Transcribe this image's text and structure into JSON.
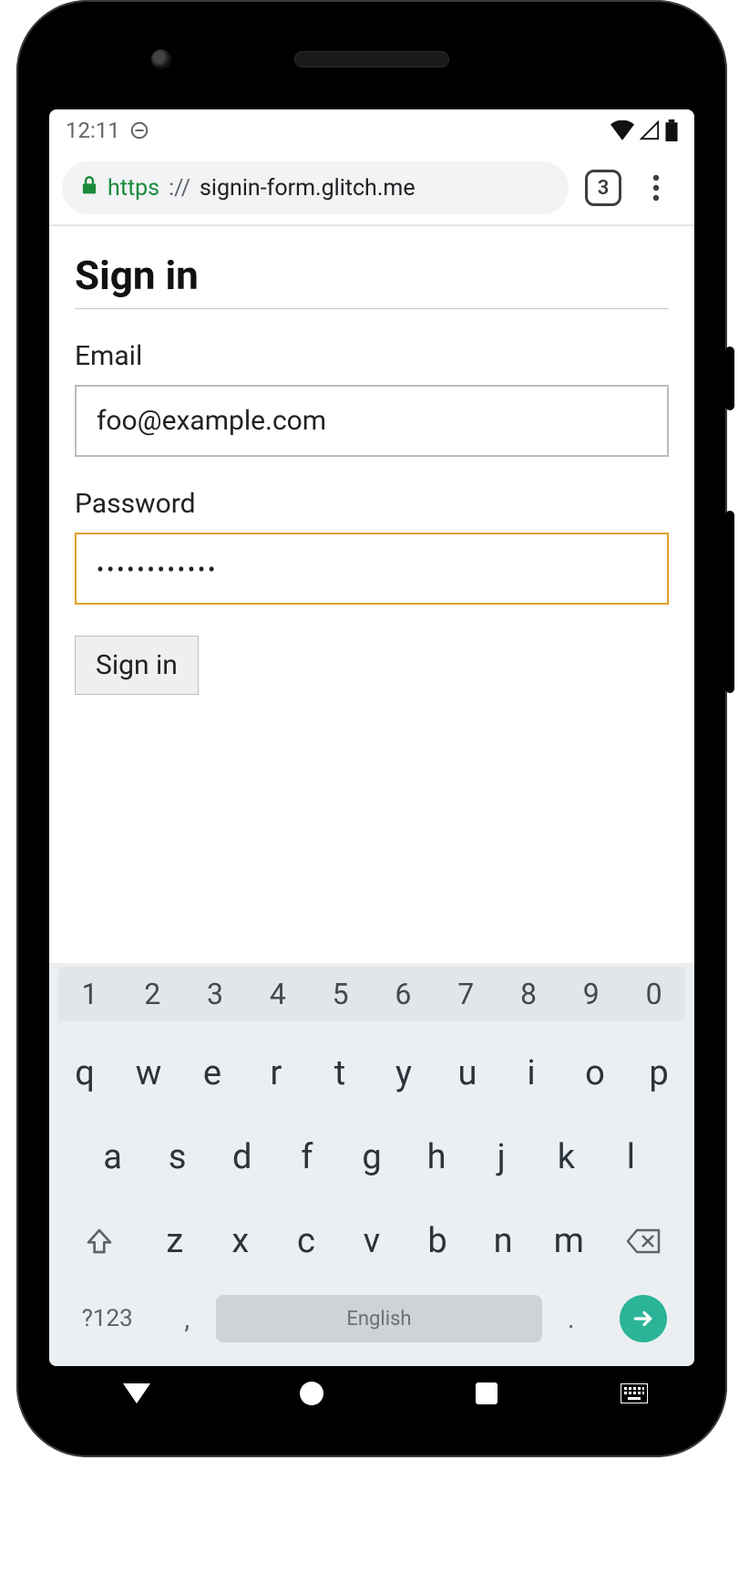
{
  "statusbar": {
    "time": "12:11"
  },
  "browser": {
    "url_protocol": "https",
    "url_sep": "://",
    "url_host": "signin-form.glitch.me",
    "tab_count": "3"
  },
  "page": {
    "title": "Sign in",
    "email_label": "Email",
    "email_value": "foo@example.com",
    "password_label": "Password",
    "password_masked": "••••••••••••",
    "submit_label": "Sign in"
  },
  "keyboard": {
    "numbers": [
      "1",
      "2",
      "3",
      "4",
      "5",
      "6",
      "7",
      "8",
      "9",
      "0"
    ],
    "row1": [
      "q",
      "w",
      "e",
      "r",
      "t",
      "y",
      "u",
      "i",
      "o",
      "p"
    ],
    "row2": [
      "a",
      "s",
      "d",
      "f",
      "g",
      "h",
      "j",
      "k",
      "l"
    ],
    "row3": [
      "z",
      "x",
      "c",
      "v",
      "b",
      "n",
      "m"
    ],
    "symbols_key": "?123",
    "comma": ",",
    "space_label": "English",
    "period": "."
  }
}
